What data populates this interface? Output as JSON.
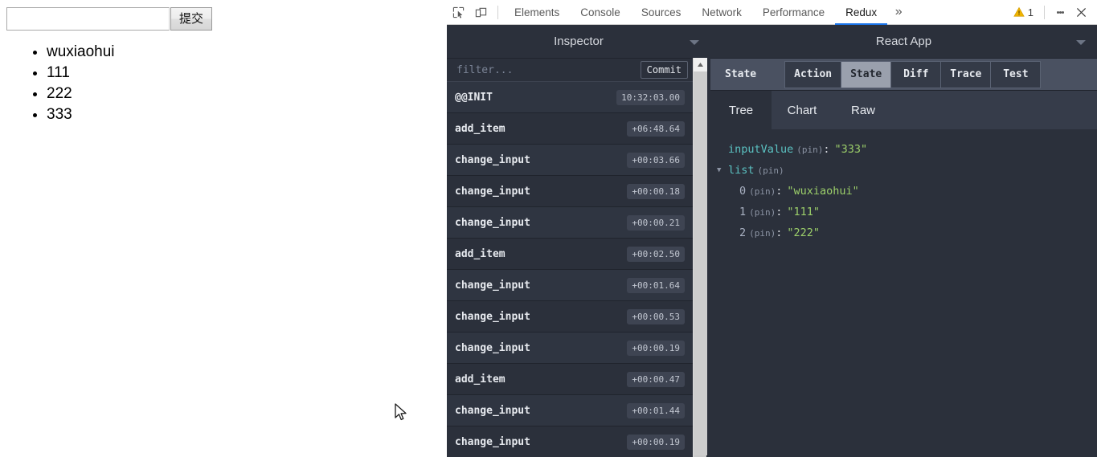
{
  "page": {
    "input_value": "",
    "input_placeholder": "",
    "submit_label": "提交",
    "items": [
      "wuxiaohui",
      "111",
      "222",
      "333"
    ]
  },
  "devtools": {
    "toolbar": {
      "inspect_icon": "inspect-element-icon",
      "device_icon": "device-toolbar-icon",
      "tabs": [
        {
          "label": "Elements",
          "active": false
        },
        {
          "label": "Console",
          "active": false
        },
        {
          "label": "Sources",
          "active": false
        },
        {
          "label": "Network",
          "active": false
        },
        {
          "label": "Performance",
          "active": false
        },
        {
          "label": "Redux",
          "active": true
        }
      ],
      "more_glyph": "»",
      "warning_count": "1",
      "warning_icon": "warning-triangle-icon",
      "warning_color": "#f0b400",
      "kebab_icon": "more-options-icon",
      "close_icon": "close-icon",
      "active_underline_color": "#1a73e8"
    },
    "headers": {
      "left_title": "Inspector",
      "right_title": "React App",
      "caret_icon": "chevron-down-icon"
    },
    "monitor": {
      "filter_placeholder": "filter...",
      "filter_value": "",
      "commit_label": "Commit",
      "actions": [
        {
          "name": "@@INIT",
          "time": "10:32:03.00"
        },
        {
          "name": "add_item",
          "time": "+06:48.64"
        },
        {
          "name": "change_input",
          "time": "+00:03.66"
        },
        {
          "name": "change_input",
          "time": "+00:00.18"
        },
        {
          "name": "change_input",
          "time": "+00:00.21"
        },
        {
          "name": "add_item",
          "time": "+00:02.50"
        },
        {
          "name": "change_input",
          "time": "+00:01.64"
        },
        {
          "name": "change_input",
          "time": "+00:00.53"
        },
        {
          "name": "change_input",
          "time": "+00:00.19"
        },
        {
          "name": "add_item",
          "time": "+00:00.47"
        },
        {
          "name": "change_input",
          "time": "+00:01.44"
        },
        {
          "name": "change_input",
          "time": "+00:00.19"
        }
      ],
      "scroll_up_icon": "scroll-up-arrow-icon"
    },
    "inspector": {
      "state_label": "State",
      "tabs": [
        {
          "label": "Action",
          "active": false
        },
        {
          "label": "State",
          "active": true
        },
        {
          "label": "Diff",
          "active": false
        },
        {
          "label": "Trace",
          "active": false
        },
        {
          "label": "Test",
          "active": false
        }
      ],
      "subtabs": [
        {
          "label": "Tree",
          "active": true
        },
        {
          "label": "Chart",
          "active": false
        },
        {
          "label": "Raw",
          "active": false
        }
      ],
      "tree": {
        "input_value_key": "inputValue",
        "input_value_pin": "(pin)",
        "input_value_colon": ":",
        "input_value_value": "\"333\"",
        "list_key": "list",
        "list_pin": "(pin)",
        "list_arrow": "▼",
        "entries": [
          {
            "index": "0",
            "pin": "(pin)",
            "colon": ":",
            "value": "\"wuxiaohui\""
          },
          {
            "index": "1",
            "pin": "(pin)",
            "colon": ":",
            "value": "\"111\""
          },
          {
            "index": "2",
            "pin": "(pin)",
            "colon": ":",
            "value": "\"222\""
          }
        ]
      }
    }
  }
}
